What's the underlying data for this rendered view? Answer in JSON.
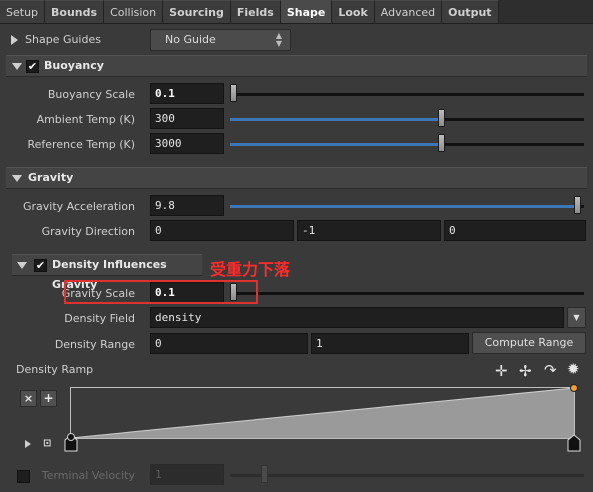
{
  "tabs": [
    {
      "label": "Setup",
      "bold": false,
      "active": false
    },
    {
      "label": "Bounds",
      "bold": true,
      "active": false
    },
    {
      "label": "Collision",
      "bold": false,
      "active": false
    },
    {
      "label": "Sourcing",
      "bold": true,
      "active": false
    },
    {
      "label": "Fields",
      "bold": true,
      "active": false
    },
    {
      "label": "Shape",
      "bold": true,
      "active": true
    },
    {
      "label": "Look",
      "bold": true,
      "active": false
    },
    {
      "label": "Advanced",
      "bold": false,
      "active": false
    },
    {
      "label": "Output",
      "bold": true,
      "active": false
    }
  ],
  "shape_guides": {
    "label": "Shape Guides",
    "value": "No Guide"
  },
  "buoyancy": {
    "header": "Buoyancy",
    "enabled": true,
    "scale": {
      "label": "Buoyancy Scale",
      "value": "0.1",
      "slider": 0.0
    },
    "ambient": {
      "label": "Ambient Temp (K)",
      "value": "300",
      "slider": 0.58
    },
    "reference": {
      "label": "Reference Temp (K)",
      "value": "3000",
      "slider": 0.58
    }
  },
  "gravity": {
    "header": "Gravity",
    "acceleration": {
      "label": "Gravity Acceleration",
      "value": "9.8",
      "slider": 0.98
    },
    "direction": {
      "label": "Gravity Direction",
      "x": "0",
      "y": "-1",
      "z": "0"
    }
  },
  "density_gravity": {
    "header": "Density Influences Gravity",
    "enabled": true,
    "annotation": "受重力下落",
    "scale": {
      "label": "Gravity Scale",
      "value": "0.1",
      "slider": 0.0
    },
    "field": {
      "label": "Density Field",
      "value": "density"
    },
    "range": {
      "label": "Density Range",
      "min": "0",
      "max": "1",
      "button": "Compute Range"
    }
  },
  "ramp": {
    "label": "Density Ramp",
    "remove_button": "×",
    "add_button": "+",
    "points": [
      {
        "pos": 0.0,
        "value": 0.0
      },
      {
        "pos": 1.0,
        "value": 1.0
      }
    ]
  },
  "terminal": {
    "label": "Terminal Velocity",
    "value": "1",
    "enabled": false
  },
  "colors": {
    "accent": "#3d77b6",
    "annotation": "#e03030",
    "ramp_point": "#f0a030"
  }
}
